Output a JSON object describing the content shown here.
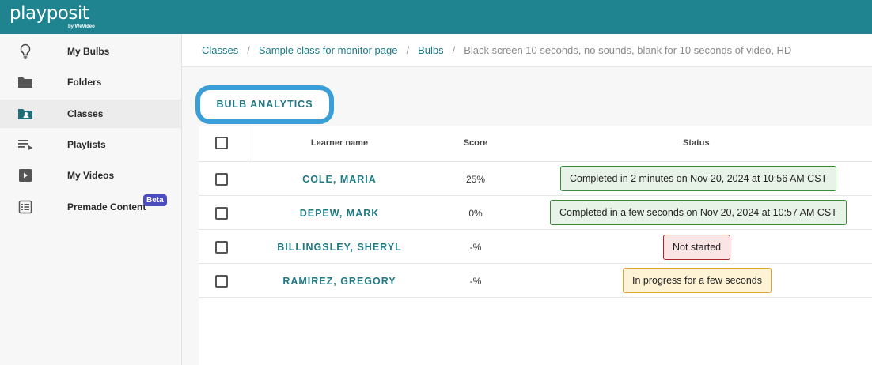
{
  "app": {
    "logo_text": "playposit",
    "logo_sub": "by WeVideo"
  },
  "sidebar": {
    "items": [
      {
        "label": "My Bulbs",
        "icon": "lightbulb-icon"
      },
      {
        "label": "Folders",
        "icon": "folder-icon"
      },
      {
        "label": "Classes",
        "icon": "class-folder-icon",
        "active": true
      },
      {
        "label": "Playlists",
        "icon": "playlist-icon"
      },
      {
        "label": "My Videos",
        "icon": "video-icon"
      },
      {
        "label": "Premade Content",
        "icon": "list-icon",
        "badge": "Beta"
      }
    ]
  },
  "breadcrumb": {
    "items": [
      "Classes",
      "Sample class for monitor page",
      "Bulbs"
    ],
    "separator": "/",
    "current": "Black screen 10 seconds, no sounds, blank for 10 seconds of video, HD"
  },
  "analytics_button": {
    "label": "BULB ANALYTICS"
  },
  "table": {
    "headers": {
      "learner": "Learner name",
      "score": "Score",
      "status": "Status"
    },
    "rows": [
      {
        "name": "COLE, MARIA",
        "score": "25%",
        "status": "Completed in 2 minutes on Nov 20, 2024 at 10:56 AM CST",
        "state": "done"
      },
      {
        "name": "DEPEW, MARK",
        "score": "0%",
        "status": "Completed in a few seconds on Nov 20, 2024 at 10:57 AM CST",
        "state": "done"
      },
      {
        "name": "BILLINGSLEY, SHERYL",
        "score": "-%",
        "status": "Not started",
        "state": "none"
      },
      {
        "name": "RAMIREZ, GREGORY",
        "score": "-%",
        "status": "In progress for a few seconds",
        "state": "prog"
      }
    ]
  },
  "colors": {
    "brand": "#1f8490",
    "link": "#1f7a86",
    "highlight": "#3a9fd8",
    "beta": "#4b4cc0",
    "complete_border": "#3a8a3a",
    "not_started_border": "#a62828",
    "in_progress_border": "#e0a730"
  }
}
